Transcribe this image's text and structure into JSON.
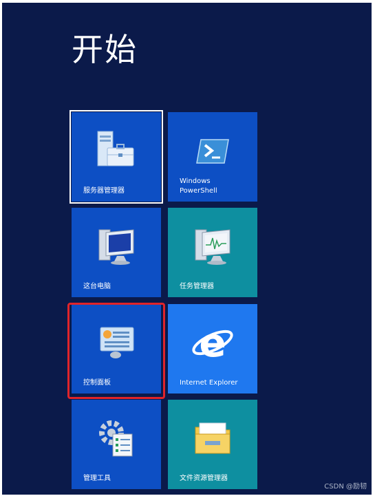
{
  "start": {
    "title": "开始"
  },
  "tiles": [
    {
      "label": "服务器管理器",
      "icon": "server-manager-icon",
      "color": "#0d4fc4"
    },
    {
      "label": "Windows\nPowerShell",
      "icon": "powershell-icon",
      "color": "#0d4fc4"
    },
    {
      "label": "这台电脑",
      "icon": "computer-icon",
      "color": "#0d4fc4"
    },
    {
      "label": "任务管理器",
      "icon": "task-manager-icon",
      "color": "#0e8fa0"
    },
    {
      "label": "控制面板",
      "icon": "control-panel-icon",
      "color": "#0d4fc4",
      "highlighted": true
    },
    {
      "label": "Internet Explorer",
      "icon": "internet-explorer-icon",
      "color": "#1f78ef"
    },
    {
      "label": "管理工具",
      "icon": "admin-tools-icon",
      "color": "#0d4fc4"
    },
    {
      "label": "文件资源管理器",
      "icon": "file-explorer-icon",
      "color": "#0e8fa0"
    }
  ],
  "watermark": "CSDN @励韧",
  "colors": {
    "background": "#0b1a4a",
    "highlight": "#e0242a"
  }
}
